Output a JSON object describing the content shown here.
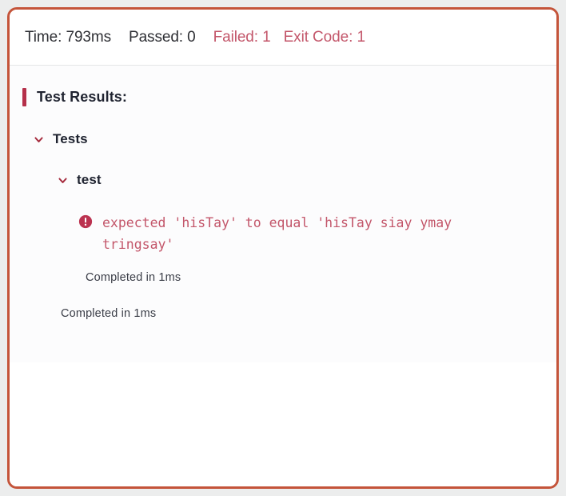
{
  "panel": {
    "border_color": "#c4543a",
    "background": "#ffffff"
  },
  "summary": {
    "stats": [
      {
        "label": "Time: 793ms",
        "tone": "neutral",
        "name": "stat-time"
      },
      {
        "label": "Passed: 0",
        "tone": "neutral",
        "name": "stat-passed"
      },
      {
        "label": "Failed: 1",
        "tone": "danger",
        "name": "stat-failed"
      },
      {
        "label": "Exit Code: 1",
        "tone": "danger",
        "name": "stat-exit-code"
      }
    ],
    "time_label": "Time: 793ms",
    "passed_label": "Passed: 0",
    "failed_label": "Failed: 1",
    "exit_code_label": "Exit Code: 1",
    "neutral_color": "#2e2f34",
    "danger_color": "#c3566a"
  },
  "results": {
    "heading": "Test Results:",
    "heading_accent_color": "#b5304a",
    "tree": {
      "root_label": "Tests",
      "child_label": "test",
      "chevron_color": "#a52a3c",
      "expanded": true
    },
    "error": {
      "icon": "error-exclamation-icon",
      "icon_color": "#bb3250",
      "message": "expected 'hisTay' to equal 'hisTay siay ymay tringsay'",
      "text_color": "#c3566a"
    },
    "completed_inner": "Completed in 1ms",
    "completed_outer": "Completed in 1ms"
  }
}
